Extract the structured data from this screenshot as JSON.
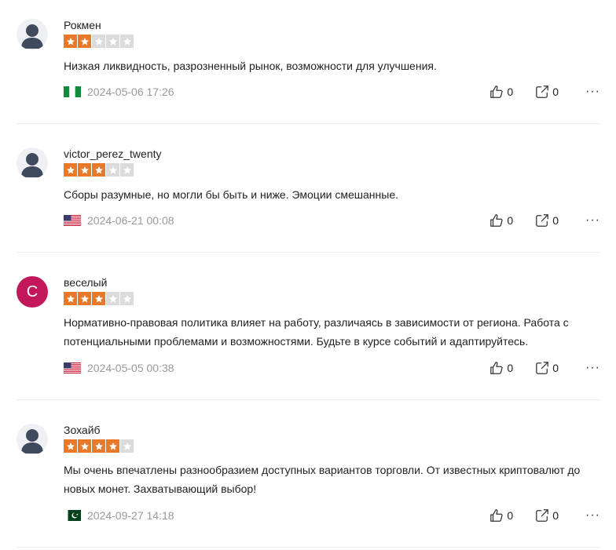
{
  "colors": {
    "star_on": "#e8782a",
    "star_off": "#dcdcdc",
    "avatar_letter_bg": "#c2185b"
  },
  "reviews": [
    {
      "name": "Рокмен",
      "rating": 2,
      "text": "Низкая ликвидность, разрозненный рынок, возможности для улучшения.",
      "flag": "nigeria-flag-icon",
      "date": "2024-05-06 17:26",
      "likes": "0",
      "shares": "0",
      "avatar": "user-silhouette-icon"
    },
    {
      "name": "victor_perez_twenty",
      "rating": 3,
      "text": "Сборы разумные, но могли бы быть и ниже. Эмоции смешанные.",
      "flag": "usa-flag-icon",
      "date": "2024-06-21 00:08",
      "likes": "0",
      "shares": "0",
      "avatar": "user-silhouette-icon"
    },
    {
      "name": "веселый",
      "rating": 3,
      "text": "Нормативно-правовая политика влияет на работу, различаясь в зависимости от региона. Работа с потенциальными проблемами и возможностями. Будьте в курсе событий и адаптируйтесь.",
      "flag": "usa-flag-icon",
      "date": "2024-05-05 00:38",
      "likes": "0",
      "shares": "0",
      "avatar_letter": "C"
    },
    {
      "name": "Зохайб",
      "rating": 4,
      "text": "Мы очень впечатлены разнообразием доступных вариантов торговли. От известных криптовалют до новых монет. Захватывающий выбор!",
      "flag": "pakistan-flag-icon",
      "date": "2024-09-27 14:18",
      "likes": "0",
      "shares": "0",
      "avatar": "user-silhouette-icon"
    }
  ]
}
